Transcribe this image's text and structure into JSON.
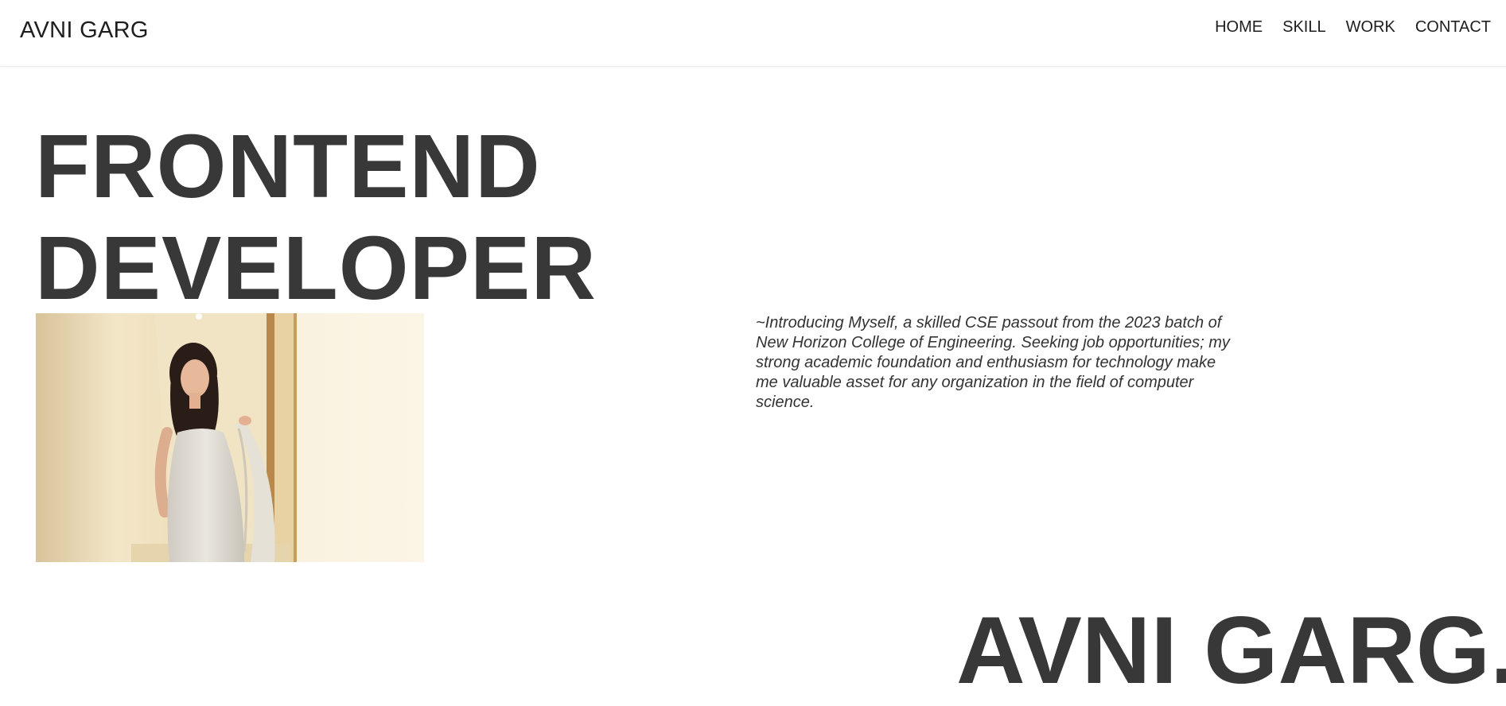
{
  "brand": "AVNI GARG",
  "nav": {
    "items": [
      "HOME",
      "SKILL",
      "WORK",
      "CONTACT"
    ]
  },
  "hero": {
    "line1": "FRONTEND",
    "line2": "DEVELOPER"
  },
  "intro": {
    "text": "~Introducing Myself, a skilled CSE passout from the 2023 batch of New Horizon College of Engineering. Seeking job opportunities; my strong academic foundation and enthusiasm for technology make me valuable asset for any organization in the field of computer science."
  },
  "footer_name": "AVNI GARG."
}
